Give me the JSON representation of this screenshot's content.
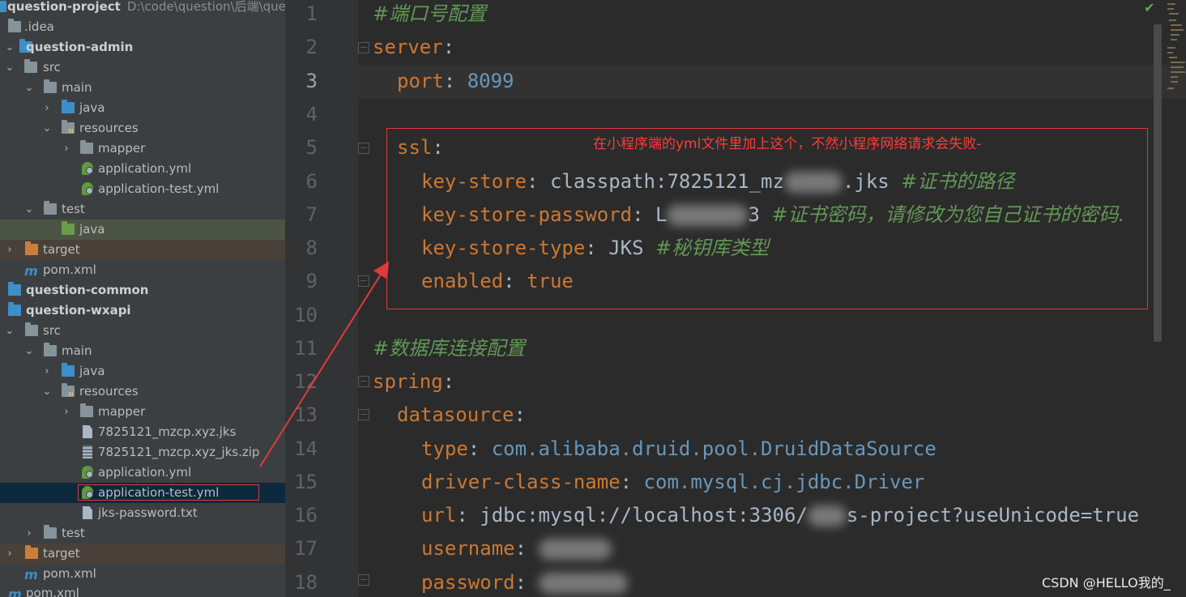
{
  "project_tree": {
    "root": {
      "name": "question-project",
      "path": "D:\\code\\question\\后端\\quest"
    },
    "rows": [
      {
        "label": ".idea",
        "icon": "folder-icon"
      },
      {
        "label": "question-admin",
        "icon": "module-folder-icon"
      },
      {
        "label": "src",
        "icon": "folder-icon"
      },
      {
        "label": "main",
        "icon": "folder-icon"
      },
      {
        "label": "java",
        "icon": "source-folder-icon"
      },
      {
        "label": "resources",
        "icon": "resources-folder-icon"
      },
      {
        "label": "mapper",
        "icon": "folder-icon"
      },
      {
        "label": "application.yml",
        "icon": "spring-config-icon"
      },
      {
        "label": "application-test.yml",
        "icon": "spring-config-icon"
      },
      {
        "label": "test",
        "icon": "folder-icon"
      },
      {
        "label": "java",
        "icon": "test-source-folder-icon"
      },
      {
        "label": "target",
        "icon": "excluded-folder-icon"
      },
      {
        "label": "pom.xml",
        "icon": "maven-icon"
      },
      {
        "label": "question-common",
        "icon": "module-folder-icon"
      },
      {
        "label": "question-wxapi",
        "icon": "module-folder-icon"
      },
      {
        "label": "src",
        "icon": "folder-icon"
      },
      {
        "label": "main",
        "icon": "folder-icon"
      },
      {
        "label": "java",
        "icon": "source-folder-icon"
      },
      {
        "label": "resources",
        "icon": "resources-folder-icon"
      },
      {
        "label": "mapper",
        "icon": "folder-icon"
      },
      {
        "label": "7825121_mzcp.xyz.jks",
        "icon": "keystore-file-icon"
      },
      {
        "label": "7825121_mzcp.xyz_jks.zip",
        "icon": "zip-file-icon"
      },
      {
        "label": "application.yml",
        "icon": "spring-config-icon"
      },
      {
        "label": "application-test.yml",
        "icon": "spring-config-icon"
      },
      {
        "label": "jks-password.txt",
        "icon": "text-file-icon"
      },
      {
        "label": "test",
        "icon": "folder-icon"
      },
      {
        "label": "target",
        "icon": "excluded-folder-icon"
      },
      {
        "label": "pom.xml",
        "icon": "maven-icon"
      },
      {
        "label": "pom.xml",
        "icon": "maven-icon"
      }
    ]
  },
  "editor": {
    "line_numbers": [
      "1",
      "2",
      "3",
      "4",
      "5",
      "6",
      "7",
      "8",
      "9",
      "10",
      "11",
      "12",
      "13",
      "14",
      "15",
      "16",
      "17",
      "18"
    ],
    "current_line": "3",
    "lines": {
      "l1_comment": "#端口号配置",
      "l2_key": "server",
      "l3_key": "port",
      "l3_val": "8099",
      "l5_key": "ssl",
      "l6_key": "key-store",
      "l6_val_a": "classpath:7825121_mz",
      "l6_val_b": ".jks",
      "l6_comment": "#证书的路径",
      "l7_key": "key-store-password",
      "l7_val_a": "L",
      "l7_val_b": "3",
      "l7_comment": "#证书密码，请修改为您自己证书的密码.",
      "l8_key": "key-store-type",
      "l8_val": "JKS",
      "l8_comment": "#秘钥库类型",
      "l9_key": "enabled",
      "l9_val": "true",
      "l11_comment": "#数据库连接配置",
      "l12_key": "spring",
      "l13_key": "datasource",
      "l14_key": "type",
      "l14_val": "com.alibaba.druid.pool.DruidDataSource",
      "l15_key": "driver-class-name",
      "l15_val": "com.mysql.cj.jdbc.Driver",
      "l16_key": "url",
      "l16_val_a": "jdbc:mysql://localhost:3306/",
      "l16_val_b": "s-project?useUnicode=true",
      "l17_key": "username",
      "l18_key": "password"
    }
  },
  "annotation": {
    "text": "在小程序端的yml文件里加上这个，不然小程序网络请求会失败-",
    "color": "#e0393e"
  },
  "watermark": "CSDN @HELLO我的_",
  "colors": {
    "keyword": "#cc7832",
    "number": "#6897bb",
    "comment": "#629755",
    "text": "#a9b7c6"
  }
}
